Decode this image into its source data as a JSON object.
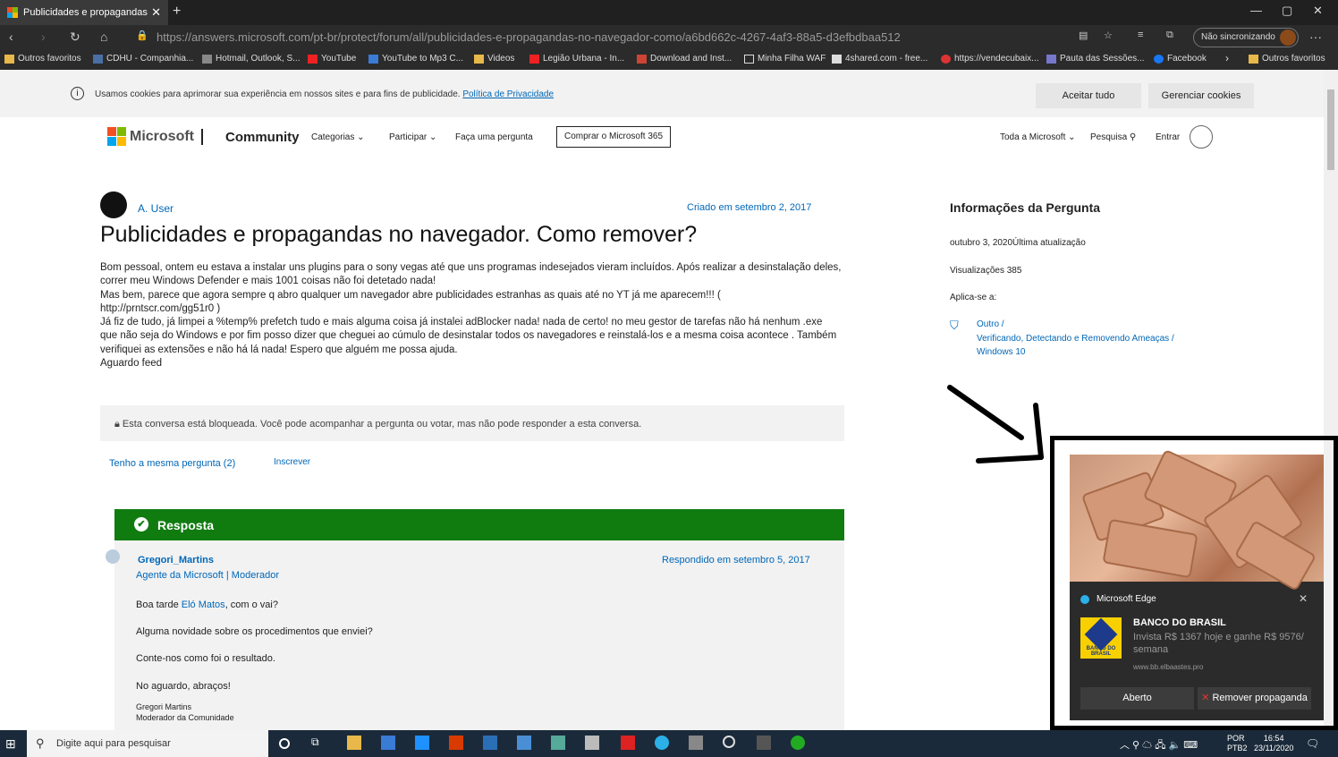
{
  "browser": {
    "tab_title": "Publicidades e propagandas no n",
    "url": "https://answers.microsoft.com/pt-br/protect/forum/all/publicidades-e-propagandas-no-navegador-como/a6bd662c-4267-4af3-88a5-d3efbdbaa512",
    "sync_label": "Não sincronizando"
  },
  "bookmarks": [
    "Outros favoritos",
    "CDHU - Companhia...",
    "Hotmail, Outlook, S...",
    "YouTube",
    "YouTube to Mp3 C...",
    "Videos",
    "Legião Urbana - In...",
    "Download and Inst...",
    "Minha Filha WAF",
    "4shared.com - free...",
    "https://vendecubaix...",
    "Pauta das Sessões...",
    "Facebook",
    "Outros favoritos"
  ],
  "cookie_bar": {
    "text": "Usamos cookies para aprimorar sua experiência em nossos sites e para fins de publicidade.",
    "link": "Política de Privacidade",
    "accept": "Aceitar tudo",
    "manage": "Gerenciar cookies"
  },
  "header": {
    "brand": "Microsoft",
    "community": "Community",
    "nav": [
      "Categorias",
      "Participar",
      "Faça uma pergunta"
    ],
    "buy": "Comprar o Microsoft 365",
    "all_microsoft": "Toda a Microsoft",
    "search": "Pesquisa",
    "signin": "Entrar"
  },
  "question": {
    "author": "A. User",
    "created": "Criado em setembro 2, 2017",
    "title": "Publicidades e propagandas no navegador. Como remover?",
    "body": [
      "Bom pessoal, ontem eu estava a instalar uns plugins para o sony vegas até que uns programas indesejados vieram  incluídos. Após realizar a desinstalação deles,",
      "correr meu  Windows Defender e mais 1001 coisas não foi detetado nada!",
      "Mas bem, parece que agora sempre q abro qualquer um navegador abre publicidades estranhas as quais até no YT já me aparecem!!! (",
      "http://prntscr.com/gg51r0 )",
      "Já fiz de tudo, já limpei a %temp% prefetch tudo e mais alguma coisa já instalei adBlocker nada! nada de certo! no meu gestor de tarefas não há nenhum .exe",
      "que não seja do Windows e por fim posso dizer que cheguei ao cúmulo de desinstalar todos os navegadores e reinstalá-los e a mesma coisa acontece . Também",
      "verifiquei as extensões e não há lá nada! Espero que alguém me possa ajuda.",
      "Aguardo feed"
    ],
    "locked": "Esta conversa está bloqueada. Você pode acompanhar a pergunta ou votar, mas não pode responder a esta conversa.",
    "same_question": "Tenho a mesma pergunta (2)",
    "subscribe": "Inscrever"
  },
  "answer": {
    "header": "Resposta",
    "author": "Gregori_Martins",
    "role": "Agente da Microsoft | Moderador",
    "date": "Respondido em setembro 5, 2017",
    "greeting_pre": "Boa tarde ",
    "greeting_link": "Eló Matos",
    "greeting_post": ", com o vai?",
    "line2": "Alguma novidade sobre os procedimentos que enviei?",
    "line3": "Conte-nos como foi o resultado.",
    "line4": "No aguardo, abraços!",
    "sig1": "Gregori Martins",
    "sig2": "Moderador da Comunidade"
  },
  "sidebar": {
    "title": "Informações da Pergunta",
    "updated": "outubro 3, 2020Última atualização",
    "views": "Visualizações 385",
    "applies": "Aplica-se a:",
    "link1": "Outro /",
    "link2": "Verificando, Detectando e Removendo Ameaças /",
    "link3": "Windows 10"
  },
  "notification": {
    "app": "Microsoft Edge",
    "logo_text": "BANCO DO BRASIL",
    "title": "BANCO DO BRASIL",
    "text": "Invista R$ 1367 hoje e ganhe R$ 9576/ semana",
    "url": "www.bb.elbaastes.pro",
    "btn_open": "Aberto",
    "btn_remove": "Remover propaganda"
  },
  "taskbar": {
    "search_placeholder": "Digite aqui para pesquisar",
    "lang1": "POR",
    "lang2": "PTB2",
    "time": "16:54",
    "date": "23/11/2020"
  },
  "colors": {
    "answer_green": "#107c10",
    "link_blue": "#0067b8"
  }
}
